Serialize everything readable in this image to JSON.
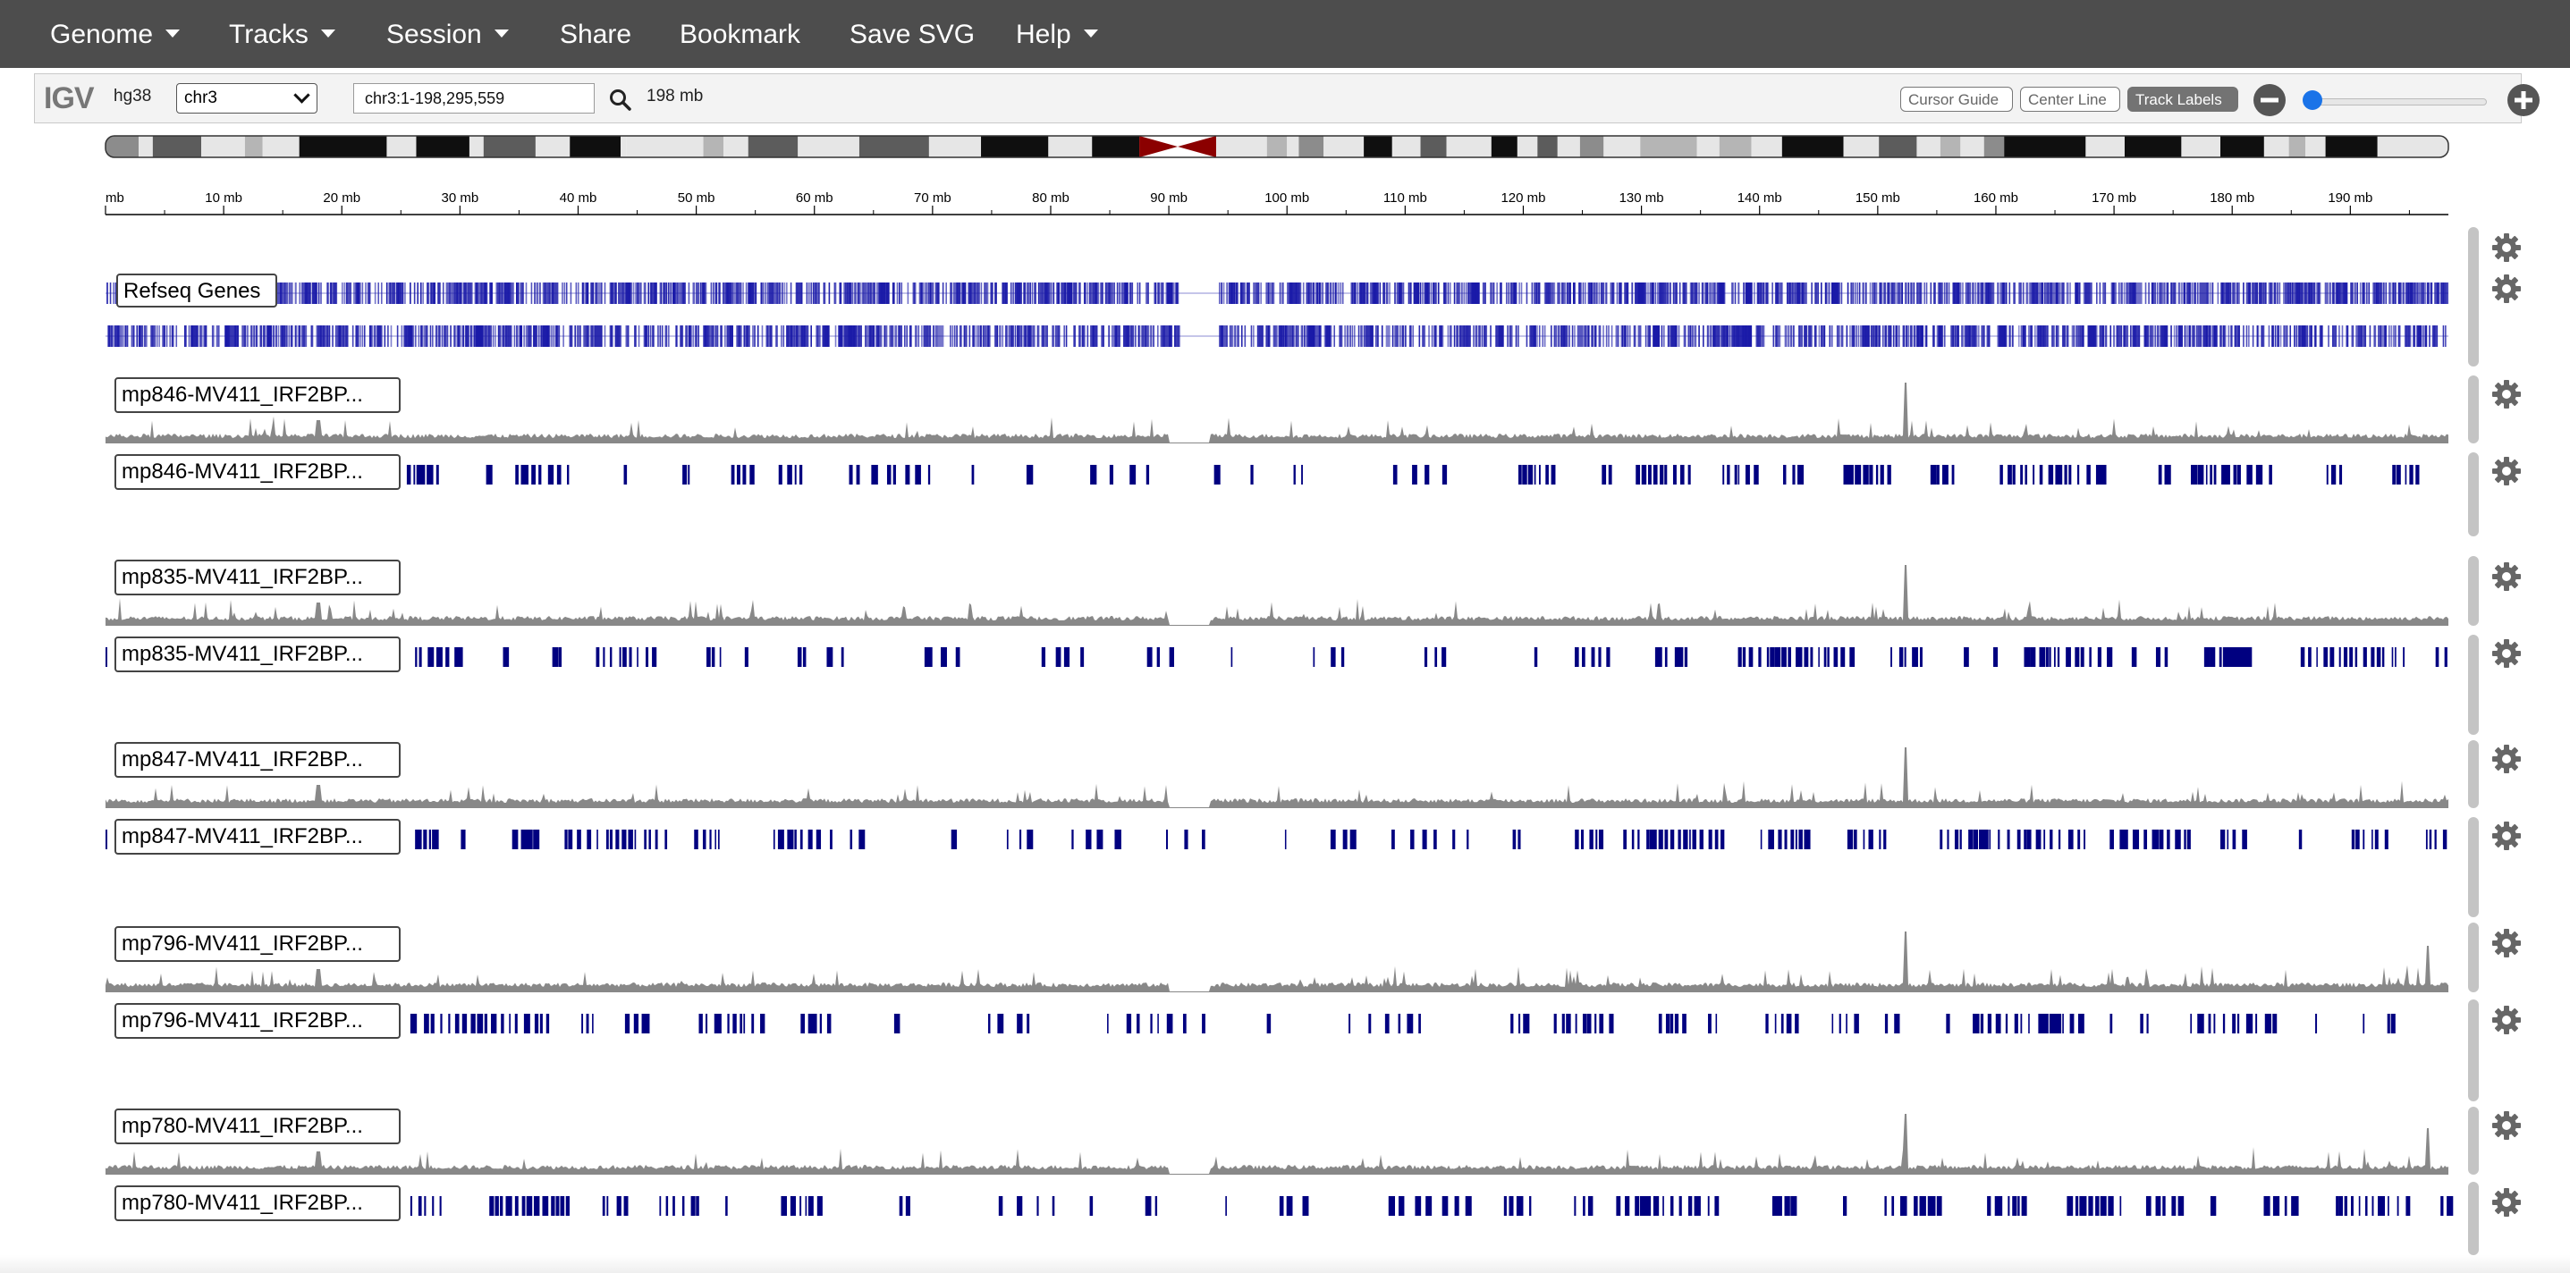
{
  "menubar": {
    "items": [
      {
        "label": "Genome",
        "dropdown": true
      },
      {
        "label": "Tracks",
        "dropdown": true
      },
      {
        "label": "Session",
        "dropdown": true
      },
      {
        "label": "Share",
        "dropdown": false
      },
      {
        "label": "Bookmark",
        "dropdown": false
      },
      {
        "label": "Save SVG",
        "dropdown": false
      },
      {
        "label": "Help",
        "dropdown": true
      }
    ]
  },
  "toolbar": {
    "logo": "IGV",
    "genome": "hg38",
    "chromosome": "chr3",
    "locus": "chr3:1-198,295,559",
    "window_size": "198 mb",
    "cursor_guide_label": "Cursor Guide",
    "center_line_label": "Center Line",
    "track_labels_label": "Track Labels",
    "track_labels_active": true,
    "zoom_level": 0.0
  },
  "ruler": {
    "tick_labels": [
      "mb",
      "10 mb",
      "20 mb",
      "30 mb",
      "40 mb",
      "50 mb",
      "60 mb",
      "70 mb",
      "80 mb",
      "90 mb",
      "100 mb",
      "110 mb",
      "120 mb",
      "130 mb",
      "140 mb",
      "150 mb",
      "160 mb",
      "170 mb",
      "180 mb",
      "190 mb"
    ],
    "range_mb": [
      0,
      198.3
    ]
  },
  "ideogram": {
    "centromere_mb": [
      87.5,
      94.0
    ],
    "bands": [
      {
        "start": 0,
        "end": 2.8,
        "stain": "gpos50"
      },
      {
        "start": 2.8,
        "end": 4,
        "stain": "gneg"
      },
      {
        "start": 4,
        "end": 8.1,
        "stain": "gpos75"
      },
      {
        "start": 8.1,
        "end": 11.8,
        "stain": "gneg"
      },
      {
        "start": 11.8,
        "end": 13.3,
        "stain": "gpos25"
      },
      {
        "start": 13.3,
        "end": 16.4,
        "stain": "gneg"
      },
      {
        "start": 16.4,
        "end": 23.8,
        "stain": "gpos100"
      },
      {
        "start": 23.8,
        "end": 26.3,
        "stain": "gneg"
      },
      {
        "start": 26.3,
        "end": 30.8,
        "stain": "gpos100"
      },
      {
        "start": 30.8,
        "end": 32,
        "stain": "gneg"
      },
      {
        "start": 32,
        "end": 36.4,
        "stain": "gpos75"
      },
      {
        "start": 36.4,
        "end": 39.3,
        "stain": "gneg"
      },
      {
        "start": 39.3,
        "end": 43.6,
        "stain": "gpos100"
      },
      {
        "start": 43.6,
        "end": 44.1,
        "stain": "gneg"
      },
      {
        "start": 44.1,
        "end": 50.6,
        "stain": "gneg"
      },
      {
        "start": 50.6,
        "end": 52.3,
        "stain": "gpos25"
      },
      {
        "start": 52.3,
        "end": 54.4,
        "stain": "gneg"
      },
      {
        "start": 54.4,
        "end": 58.6,
        "stain": "gpos75"
      },
      {
        "start": 58.6,
        "end": 63.8,
        "stain": "gneg"
      },
      {
        "start": 63.8,
        "end": 69.7,
        "stain": "gpos75"
      },
      {
        "start": 69.7,
        "end": 74.1,
        "stain": "gneg"
      },
      {
        "start": 74.1,
        "end": 79.8,
        "stain": "gpos100"
      },
      {
        "start": 79.8,
        "end": 83.5,
        "stain": "gneg"
      },
      {
        "start": 83.5,
        "end": 87.5,
        "stain": "gpos100"
      },
      {
        "start": 94,
        "end": 98.3,
        "stain": "gneg"
      },
      {
        "start": 98.3,
        "end": 100,
        "stain": "gpos25"
      },
      {
        "start": 100,
        "end": 101,
        "stain": "gneg"
      },
      {
        "start": 101,
        "end": 103.1,
        "stain": "gpos50"
      },
      {
        "start": 103.1,
        "end": 106.5,
        "stain": "gneg"
      },
      {
        "start": 106.5,
        "end": 108.9,
        "stain": "gpos100"
      },
      {
        "start": 108.9,
        "end": 111.3,
        "stain": "gneg"
      },
      {
        "start": 111.3,
        "end": 113.5,
        "stain": "gpos75"
      },
      {
        "start": 113.5,
        "end": 117.3,
        "stain": "gneg"
      },
      {
        "start": 117.3,
        "end": 119.5,
        "stain": "gpos100"
      },
      {
        "start": 119.5,
        "end": 121.2,
        "stain": "gneg"
      },
      {
        "start": 121.2,
        "end": 122.9,
        "stain": "gpos75"
      },
      {
        "start": 122.9,
        "end": 124.8,
        "stain": "gneg"
      },
      {
        "start": 124.8,
        "end": 126.8,
        "stain": "gpos50"
      },
      {
        "start": 126.8,
        "end": 129.9,
        "stain": "gneg"
      },
      {
        "start": 129.9,
        "end": 134.7,
        "stain": "gpos25"
      },
      {
        "start": 134.7,
        "end": 136.6,
        "stain": "gneg"
      },
      {
        "start": 136.6,
        "end": 139.3,
        "stain": "gpos25"
      },
      {
        "start": 139.3,
        "end": 141.9,
        "stain": "gneg"
      },
      {
        "start": 141.9,
        "end": 147.1,
        "stain": "gpos100"
      },
      {
        "start": 147.1,
        "end": 150.1,
        "stain": "gneg"
      },
      {
        "start": 150.1,
        "end": 153.3,
        "stain": "gpos75"
      },
      {
        "start": 153.3,
        "end": 155.3,
        "stain": "gneg"
      },
      {
        "start": 155.3,
        "end": 157,
        "stain": "gpos25"
      },
      {
        "start": 157,
        "end": 159,
        "stain": "gneg"
      },
      {
        "start": 159,
        "end": 160.7,
        "stain": "gpos50"
      },
      {
        "start": 160.7,
        "end": 167.6,
        "stain": "gpos100"
      },
      {
        "start": 167.6,
        "end": 170.9,
        "stain": "gneg"
      },
      {
        "start": 170.9,
        "end": 175.7,
        "stain": "gpos100"
      },
      {
        "start": 175.7,
        "end": 179,
        "stain": "gneg"
      },
      {
        "start": 179,
        "end": 182.7,
        "stain": "gpos100"
      },
      {
        "start": 182.7,
        "end": 184.8,
        "stain": "gneg"
      },
      {
        "start": 184.8,
        "end": 186.2,
        "stain": "gpos25"
      },
      {
        "start": 186.2,
        "end": 187.9,
        "stain": "gneg"
      },
      {
        "start": 187.9,
        "end": 192.3,
        "stain": "gpos100"
      },
      {
        "start": 192.3,
        "end": 198.3,
        "stain": "gneg"
      }
    ]
  },
  "tracks": [
    {
      "name": "Refseq Genes",
      "type": "annotation",
      "color": "#1a1aa8"
    },
    {
      "name": "mp846-MV411_IRF2BP...",
      "type": "signal",
      "color": "#888888"
    },
    {
      "name": "mp846-MV411_IRF2BP...",
      "type": "peaks",
      "color": "#000080"
    },
    {
      "name": "mp835-MV411_IRF2BP...",
      "type": "signal",
      "color": "#888888"
    },
    {
      "name": "mp835-MV411_IRF2BP...",
      "type": "peaks",
      "color": "#000080"
    },
    {
      "name": "mp847-MV411_IRF2BP...",
      "type": "signal",
      "color": "#888888"
    },
    {
      "name": "mp847-MV411_IRF2BP...",
      "type": "peaks",
      "color": "#000080"
    },
    {
      "name": "mp796-MV411_IRF2BP...",
      "type": "signal",
      "color": "#888888"
    },
    {
      "name": "mp796-MV411_IRF2BP...",
      "type": "peaks",
      "color": "#000080"
    },
    {
      "name": "mp780-MV411_IRF2BP...",
      "type": "signal",
      "color": "#888888"
    },
    {
      "name": "mp780-MV411_IRF2BP...",
      "type": "peaks",
      "color": "#000080"
    }
  ],
  "colors": {
    "menubar": "#4d4d4d",
    "centromere": "#8b0000",
    "peaks": "#000080",
    "signal": "#888888",
    "genes": "#1a1aa8"
  }
}
